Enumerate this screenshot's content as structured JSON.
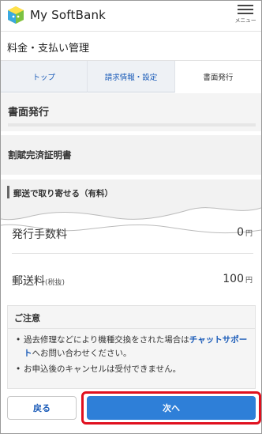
{
  "header": {
    "brand": "My SoftBank",
    "menu_label": "メニュー"
  },
  "page": {
    "title": "料金・支払い管理"
  },
  "tabs": [
    {
      "label": "トップ",
      "active": false
    },
    {
      "label": "請求情報・設定",
      "active": false
    },
    {
      "label": "書面発行",
      "active": true
    }
  ],
  "sections": {
    "heading": "書面発行",
    "subheading": "割賦完済証明書",
    "delivery": "郵送で取り寄せる（有料）"
  },
  "fees": {
    "issue_fee_label": "発行手数料",
    "issue_fee_value": "0",
    "postage_label": "郵送料",
    "postage_note": "(税抜)",
    "postage_value": "100",
    "currency": "円"
  },
  "notice": {
    "title": "ご注意",
    "item1_text": "過去修理などにより機種交換をされた場合は",
    "item1_link": "チャットサポート",
    "item1_tail": "へお問い合わせください。",
    "item2_text": "お申込後のキャンセルは受付できません。",
    "bullet": "•"
  },
  "buttons": {
    "back": "戻る",
    "next": "次へ"
  },
  "colors": {
    "link": "#1a5bb8",
    "primary_button": "#2e7fd8",
    "highlight": "#e0101f"
  }
}
